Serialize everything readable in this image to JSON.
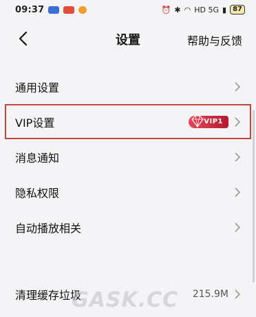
{
  "status_bar": {
    "time": "09:37",
    "battery": "87",
    "network": "HD 5G"
  },
  "nav": {
    "back_icon": "chevron-left-icon",
    "title": "设置",
    "help": "帮助与反馈"
  },
  "settings": {
    "items": [
      {
        "label": "通用设置"
      },
      {
        "label": "VIP设置",
        "badge": "VIP1"
      },
      {
        "label": "消息通知"
      },
      {
        "label": "隐私权限"
      },
      {
        "label": "自动播放相关"
      }
    ],
    "cache": {
      "label": "清理缓存垃圾",
      "value": "215.9M"
    }
  },
  "watermark": "GASK.CC",
  "colors": {
    "highlight_border": "#c4453a",
    "vip_badge": "#c8263a",
    "background": "#f4f4f6"
  }
}
